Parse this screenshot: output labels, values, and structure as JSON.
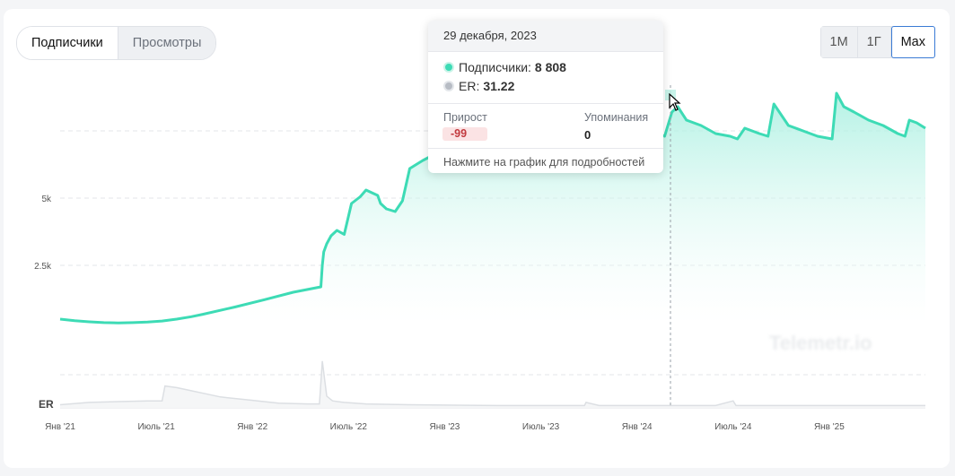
{
  "tabs": [
    {
      "label": "Подписчики",
      "active": true
    },
    {
      "label": "Просмотры",
      "active": false
    }
  ],
  "ranges": [
    {
      "label": "1М",
      "active": false
    },
    {
      "label": "1Г",
      "active": false
    },
    {
      "label": "Max",
      "active": true
    }
  ],
  "tooltip": {
    "date": "29 декабря, 2023",
    "subs_label": "Подписчики:",
    "subs_value": "8 808",
    "er_label": "ER:",
    "er_value": "31.22",
    "growth_label": "Прирост",
    "growth_value": "-99",
    "mentions_label": "Упоминания",
    "mentions_value": "0",
    "footer": "Нажмите на график для подробностей"
  },
  "watermark": "Telemetr.io",
  "colors": {
    "subs_line": "#3ddbb5",
    "subs_fill_top": "#9feedd",
    "er_line": "#dcdfe3",
    "growth_negative": "#c23a3f"
  },
  "chart_data": {
    "type": "area",
    "x_tick_labels": [
      "Янв '21",
      "Июль '21",
      "Янв '22",
      "Июль '22",
      "Янв '23",
      "Июль '23",
      "Янв '24",
      "Июль '24",
      "Янв '25"
    ],
    "y_tick_labels": [
      "5k",
      "2.5k"
    ],
    "er_axis_label": "ER",
    "grid": "dashed horizontal",
    "series": [
      {
        "name": "Подписчики",
        "unit": "months since Jan 2021",
        "x": [
          0,
          0.5,
          1,
          2,
          3,
          4,
          5,
          6,
          7,
          8,
          9,
          9.8,
          12,
          14,
          16,
          17.9,
          18.0,
          18.1,
          18.3,
          18.6,
          19.0,
          19.5,
          20.0,
          20.6,
          21.0,
          21.4,
          21.8,
          22.0,
          22.4,
          23.0,
          23.5,
          24.0,
          24.6,
          24.9,
          25.6,
          26.5,
          27.5,
          28.5,
          29.3,
          29.7,
          30.0,
          30.6,
          31.0,
          31.4,
          32.0,
          33.0,
          34.0,
          35.0,
          35.5,
          35.8,
          36.2,
          36.8,
          37.3,
          37.9,
          38.5,
          39.0,
          40.0,
          41.0,
          41.5,
          42.0,
          42.4,
          43.0,
          44.0,
          45.0,
          46.0,
          46.5,
          47.0,
          48.0,
          48.6,
          49.0,
          50.0,
          51.0,
          52.0,
          53.0,
          53.3,
          53.8,
          54.5,
          55.5,
          56.5,
          57.5,
          58.0,
          58.3,
          58.8,
          59.4
        ],
        "values": [
          200,
          170,
          140,
          100,
          70,
          60,
          70,
          90,
          130,
          200,
          290,
          380,
          650,
          920,
          1200,
          1400,
          2200,
          2700,
          3000,
          3300,
          3500,
          3350,
          4500,
          4750,
          5000,
          4900,
          4800,
          4500,
          4300,
          4200,
          4600,
          5800,
          6000,
          6100,
          6300,
          6900,
          7000,
          7100,
          7200,
          7300,
          7150,
          7400,
          7500,
          7000,
          6600,
          6900,
          7200,
          7500,
          7900,
          8600,
          9300,
          9100,
          8808,
          9000,
          8200,
          7800,
          7400,
          7100,
          7000,
          7900,
          8100,
          7600,
          7400,
          7100,
          7000,
          6900,
          7300,
          7100,
          7000,
          8200,
          7400,
          7200,
          7000,
          6900,
          8600,
          8100,
          7900,
          7600,
          7400,
          7100,
          7000,
          7600,
          7500,
          7300
        ]
      },
      {
        "name": "ER",
        "unit": "months since Jan 2021",
        "x": [
          0,
          2,
          4,
          6,
          7,
          7.2,
          8,
          9,
          10,
          11,
          13,
          15,
          17,
          17.8,
          18.0,
          18.3,
          18.7,
          19.5,
          21,
          24,
          30,
          36,
          36.1,
          37,
          40,
          45,
          46.2,
          46.4,
          48,
          52,
          55,
          59.4
        ],
        "values": [
          4,
          7,
          8,
          9,
          9,
          28,
          26,
          22,
          18,
          14,
          10,
          6,
          5,
          5,
          60,
          15,
          9,
          7,
          5,
          4,
          3,
          3,
          7,
          3,
          3,
          3,
          9,
          3,
          3,
          3,
          3,
          3
        ]
      }
    ],
    "highlight": {
      "x": 35.9,
      "date": "29 декабря, 2023"
    }
  }
}
